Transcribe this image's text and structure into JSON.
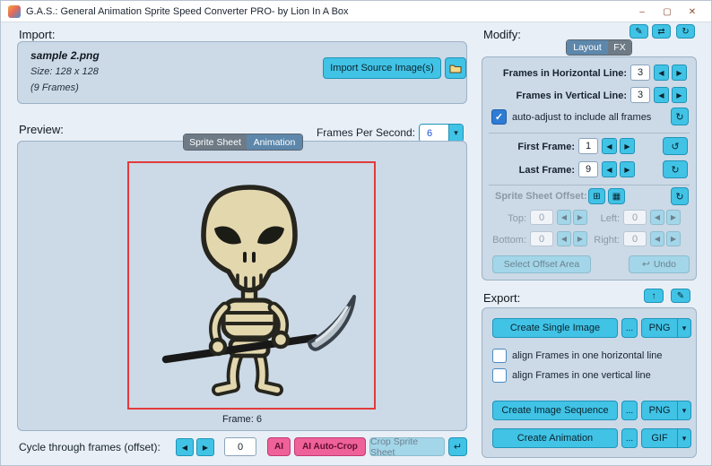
{
  "colors": {
    "accent_cyan": "#41c3e6",
    "accent_pink": "#ef6199",
    "tab_active_blue": "#5d87ab",
    "tab_inactive_gray": "#6e7a85",
    "frame_border_red": "#e23b3b",
    "checkbox_blue": "#2f7bd3",
    "panel_bg": "#ccd9e7",
    "window_bg": "#e9eff6"
  },
  "icons": {
    "minimize": "–",
    "maximize": "▢",
    "close": "✕",
    "left_arrow": "◀",
    "right_arrow": "▶",
    "dropdown_arrow": "▾",
    "check": "✓",
    "refresh": "↻",
    "reset_first": "↺",
    "reset_last": "↻",
    "enter": "↵",
    "undo": "↩",
    "ellipsis": "...",
    "brush": "✎",
    "transfer": "⇄",
    "offset_mode": "⊞",
    "offset_grid": "▦",
    "export_up": "↑",
    "export_edit": "✎"
  },
  "titlebar": {
    "title": "G.A.S.: General Animation Sprite Speed Converter PRO- by Lion In A Box"
  },
  "import_section": {
    "label": "Import:",
    "filename": "sample 2.png",
    "size_text": "Size: 128 x 128",
    "frames_text": "(9 Frames)",
    "import_button": "Import Source Image(s)"
  },
  "preview_section": {
    "label": "Preview:",
    "fps_label": "Frames Per Second:",
    "fps_value": "6",
    "tabs": [
      {
        "label": "Sprite Sheet"
      },
      {
        "label": "Animation"
      }
    ],
    "frame_label": "Frame: 6"
  },
  "cycle_bar": {
    "label": "Cycle through frames (offset):",
    "offset_value": "0",
    "ai_button": "AI",
    "ai_autocrop_button": "AI Auto-Crop",
    "crop_button": "Crop Sprite Sheet"
  },
  "modify_section": {
    "label": "Modify:",
    "tabs": [
      {
        "label": "Layout"
      },
      {
        "label": "FX"
      }
    ],
    "frames_horizontal_label": "Frames in Horizontal Line:",
    "frames_horizontal_value": "3",
    "frames_vertical_label": "Frames in Vertical Line:",
    "frames_vertical_value": "3",
    "auto_adjust_label": "auto-adjust to include all frames",
    "first_frame_label": "First Frame:",
    "first_frame_value": "1",
    "last_frame_label": "Last Frame:",
    "last_frame_value": "9",
    "offset_label": "Sprite Sheet Offset:",
    "offset_top_label": "Top:",
    "offset_top_value": "0",
    "offset_left_label": "Left:",
    "offset_left_value": "0",
    "offset_bottom_label": "Bottom:",
    "offset_bottom_value": "0",
    "offset_right_label": "Right:",
    "offset_right_value": "0",
    "select_offset_button": "Select Offset Area",
    "undo_button": "Undo"
  },
  "export_section": {
    "label": "Export:",
    "create_single_image_button": "Create Single Image",
    "single_image_format": "PNG",
    "align_horizontal_label": "align Frames in one horizontal line",
    "align_vertical_label": "align Frames in one vertical line",
    "create_image_sequence_button": "Create Image Sequence",
    "image_sequence_format": "PNG",
    "create_animation_button": "Create Animation",
    "animation_format": "GIF"
  }
}
